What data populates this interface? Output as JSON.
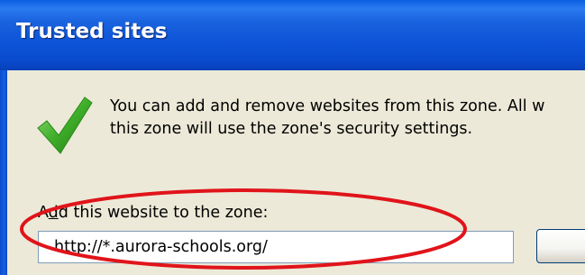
{
  "dialog": {
    "title": "Trusted sites",
    "description_line1": "You can add and remove websites from this zone. All w",
    "description_line2": "this zone will use the zone's security settings.",
    "add_label_prefix": "A",
    "add_label_mnemonic": "d",
    "add_label_suffix": "d this website to the zone:",
    "url_value": "http://*.aurora-schools.org/"
  },
  "icons": {
    "status": "checkmark-icon"
  },
  "colors": {
    "titlebar": "#0a54d8",
    "window_background": "#ece9d8",
    "highlight_annotation": "#e0141a",
    "checkmark": "#3fae2a"
  }
}
